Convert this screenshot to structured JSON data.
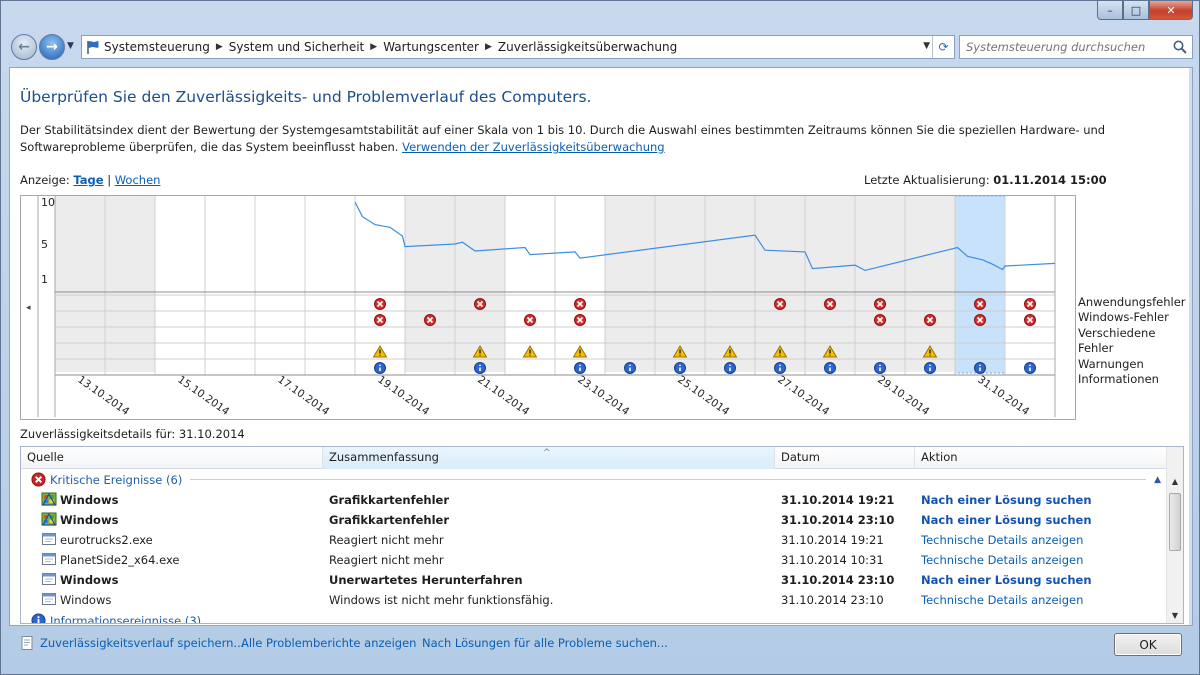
{
  "window": {
    "minimize_glyph": "–",
    "maximize_glyph": "□",
    "close_glyph": "✕"
  },
  "address": {
    "crumbs": [
      "Systemsteuerung",
      "System und Sicherheit",
      "Wartungscenter",
      "Zuverlässigkeitsüberwachung"
    ],
    "search_placeholder": "Systemsteuerung durchsuchen"
  },
  "page": {
    "title": "Überprüfen Sie den Zuverlässigkeits- und Problemverlauf des Computers.",
    "intro": "Der Stabilitätsindex dient der Bewertung der Systemgesamtstabilität auf einer Skala von 1 bis 10. Durch die Auswahl eines bestimmten Zeitraums können Sie die speziellen Hardware- und Softwareprobleme überprüfen, die das System beeinflusst haben.",
    "intro_link": "Verwenden der Zuverlässigkeitsüberwachung",
    "view_label": "Anzeige:",
    "view_days": "Tage",
    "view_sep": "|",
    "view_weeks": "Wochen",
    "last_update_label": "Letzte Aktualisierung:",
    "last_update_value": "01.11.2014 15:00",
    "details_label": "Zuverlässigkeitsdetails für: 31.10.2014"
  },
  "chart_data": {
    "type": "line",
    "y_ticks": [
      10,
      5,
      1
    ],
    "ylim": [
      0,
      10
    ],
    "columns": 20,
    "selected_column": 18,
    "shaded_columns": [
      0,
      1,
      7,
      8,
      11,
      12,
      13,
      14,
      15,
      16,
      17
    ],
    "date_labels": [
      {
        "col": 1,
        "text": "13.10.2014"
      },
      {
        "col": 3,
        "text": "15.10.2014"
      },
      {
        "col": 5,
        "text": "17.10.2014"
      },
      {
        "col": 7,
        "text": "19.10.2014"
      },
      {
        "col": 9,
        "text": "21.10.2014"
      },
      {
        "col": 11,
        "text": "23.10.2014"
      },
      {
        "col": 13,
        "text": "25.10.2014"
      },
      {
        "col": 15,
        "text": "27.10.2014"
      },
      {
        "col": 17,
        "text": "29.10.2014"
      },
      {
        "col": 19,
        "text": "31.10.2014"
      }
    ],
    "stability_line": [
      [
        6.0,
        10.0
      ],
      [
        6.15,
        8.1
      ],
      [
        6.4,
        7.2
      ],
      [
        6.7,
        6.9
      ],
      [
        6.95,
        5.9
      ],
      [
        7.0,
        4.7
      ],
      [
        8.0,
        5.0
      ],
      [
        8.15,
        5.2
      ],
      [
        8.4,
        4.2
      ],
      [
        9.4,
        4.6
      ],
      [
        9.5,
        3.8
      ],
      [
        10.4,
        4.1
      ],
      [
        10.5,
        3.4
      ],
      [
        14.0,
        6.0
      ],
      [
        14.2,
        4.3
      ],
      [
        15.0,
        4.1
      ],
      [
        15.15,
        2.2
      ],
      [
        16.0,
        2.6
      ],
      [
        16.2,
        2.0
      ],
      [
        18.05,
        4.6
      ],
      [
        18.25,
        3.6
      ],
      [
        18.55,
        3.2
      ],
      [
        18.75,
        2.7
      ],
      [
        18.95,
        2.1
      ],
      [
        19.0,
        2.5
      ],
      [
        20.0,
        2.8
      ]
    ],
    "event_rows": [
      "Anwendungsfehler",
      "Windows-Fehler",
      "Verschiedene Fehler",
      "Warnungen",
      "Informationen"
    ],
    "events": {
      "Anwendungsfehler": [
        6,
        8,
        10,
        14,
        15,
        16,
        18,
        19
      ],
      "Windows-Fehler": [
        6,
        7,
        9,
        10,
        16,
        17,
        18,
        19
      ],
      "Verschiedene Fehler": [],
      "Warnungen": [
        6,
        8,
        9,
        10,
        12,
        13,
        14,
        15,
        17
      ],
      "Informationen": [
        6,
        8,
        10,
        11,
        12,
        13,
        14,
        15,
        16,
        17,
        18,
        19
      ]
    },
    "colors": {
      "line": "#3b8ee6",
      "shade": "#ececec",
      "selected": "#c9e2fb",
      "selected_border": "#7aaee6"
    }
  },
  "table": {
    "headers": [
      "Quelle",
      "Zusammenfassung",
      "Datum",
      "Aktion"
    ],
    "group_critical": "Kritische Ereignisse (6)",
    "group_info": "Informationsereignisse (3)",
    "rows": [
      {
        "source": "Windows",
        "summary": "Grafikkartenfehler",
        "date": "31.10.2014 19:21",
        "action": "Nach einer Lösung suchen",
        "bold": true,
        "icon": "windows-logo-icon"
      },
      {
        "source": "Windows",
        "summary": "Grafikkartenfehler",
        "date": "31.10.2014 23:10",
        "action": "Nach einer Lösung suchen",
        "bold": true,
        "icon": "windows-logo-icon"
      },
      {
        "source": "eurotrucks2.exe",
        "summary": "Reagiert nicht mehr",
        "date": "31.10.2014 19:21",
        "action": "Technische Details anzeigen",
        "bold": false,
        "icon": "application-window-icon"
      },
      {
        "source": "PlanetSide2_x64.exe",
        "summary": "Reagiert nicht mehr",
        "date": "31.10.2014 10:31",
        "action": "Technische Details anzeigen",
        "bold": false,
        "icon": "application-window-icon"
      },
      {
        "source": "Windows",
        "summary": "Unerwartetes Herunterfahren",
        "date": "31.10.2014 23:10",
        "action": "Nach einer Lösung suchen",
        "bold": true,
        "icon": "application-window-icon"
      },
      {
        "source": "Windows",
        "summary": "Windows ist nicht mehr funktionsfähig.",
        "date": "31.10.2014 23:10",
        "action": "Technische Details anzeigen",
        "bold": false,
        "icon": "application-window-icon"
      }
    ]
  },
  "footer": {
    "save_link": "Zuverlässigkeitsverlauf speichern...",
    "reports_link": "Alle Problemberichte anzeigen",
    "solutions_link": "Nach Lösungen für alle Probleme suchen...",
    "ok_label": "OK"
  }
}
